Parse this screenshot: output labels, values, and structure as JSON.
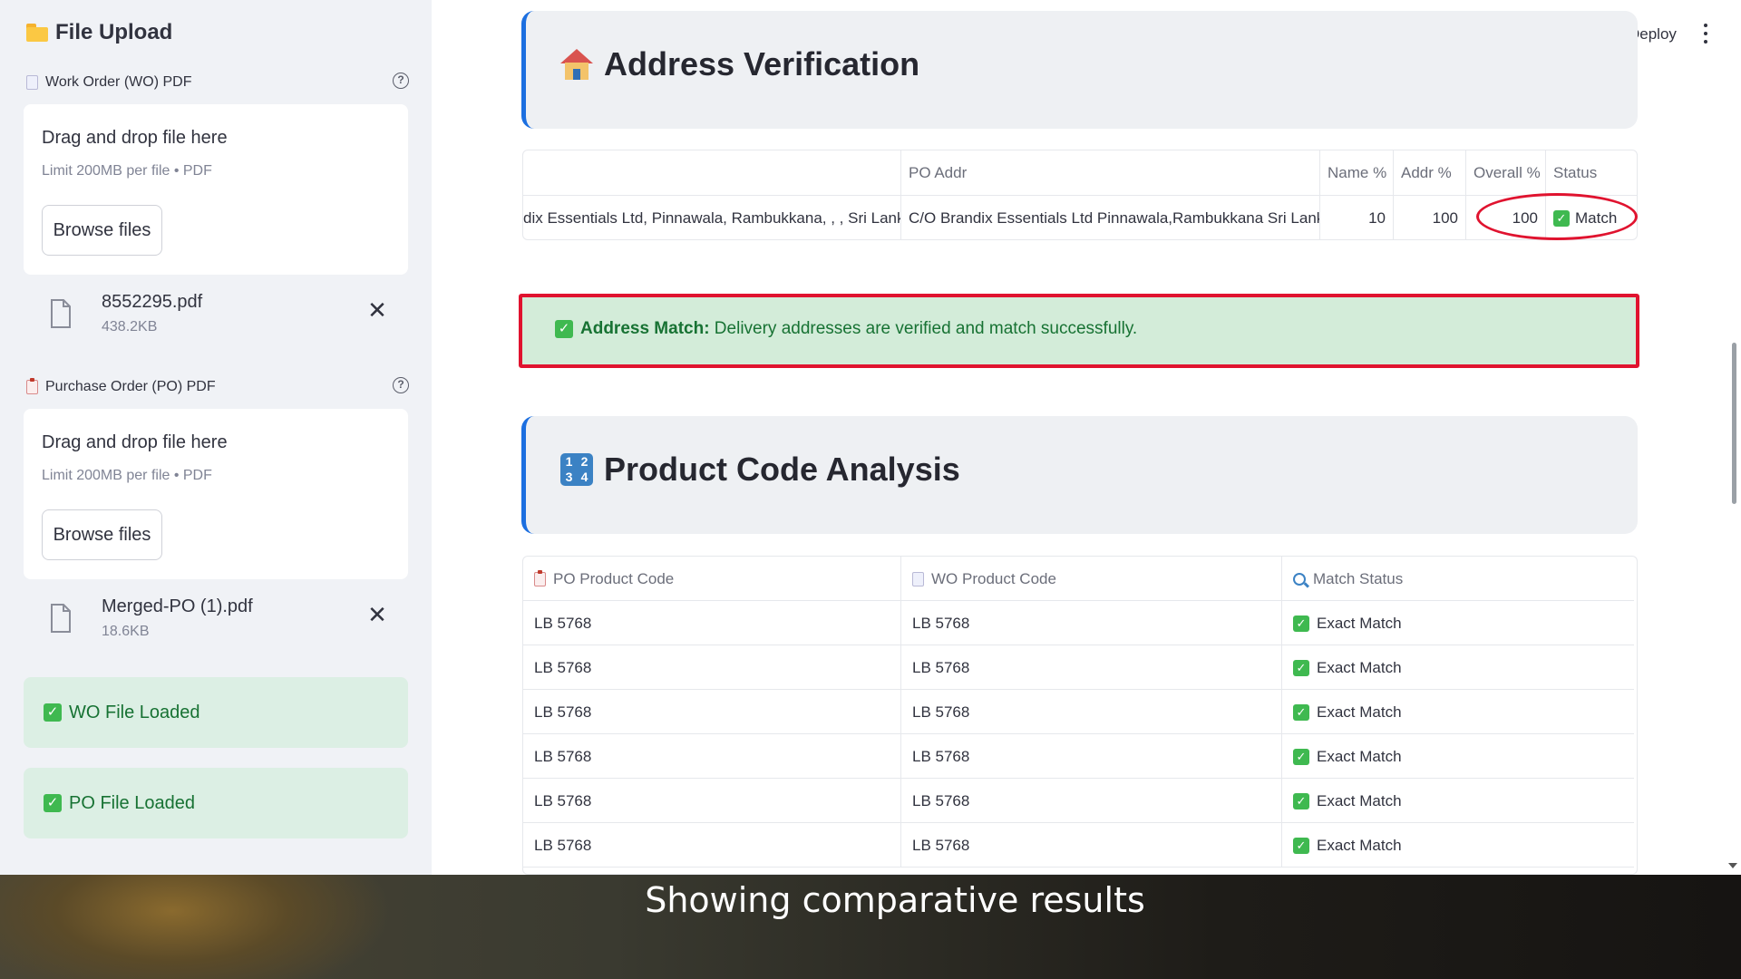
{
  "sidebar": {
    "title": "File Upload",
    "wo_uploader": {
      "label": "Work Order (WO) PDF",
      "help": "?",
      "drop_text": "Drag and drop file here",
      "limit_text": "Limit 200MB per file • PDF",
      "browse_label": "Browse files",
      "file": {
        "name": "8552295.pdf",
        "size": "438.2KB"
      }
    },
    "po_uploader": {
      "label": "Purchase Order (PO) PDF",
      "help": "?",
      "drop_text": "Drag and drop file here",
      "limit_text": "Limit 200MB per file • PDF",
      "browse_label": "Browse files",
      "file": {
        "name": "Merged-PO (1).pdf",
        "size": "18.6KB"
      }
    },
    "status_boxes": [
      "WO File Loaded",
      "PO File Loaded"
    ]
  },
  "header": {
    "deploy_label": "Deploy"
  },
  "address_section": {
    "title": "Address Verification",
    "table": {
      "headers": [
        "",
        "PO Addr",
        "Name %",
        "Addr %",
        "Overall %",
        "Status"
      ],
      "row": {
        "wo_addr": "dix Essentials Ltd, Pinnawala, Rambukkana, , , Sri Lanka",
        "po_addr": "C/O Brandix Essentials Ltd Pinnawala,Rambukkana Sri Lanka",
        "name_pct": "10",
        "addr_pct": "100",
        "overall_pct": "100",
        "status": "Match"
      }
    },
    "alert": {
      "bold": "Address Match:",
      "text": " Delivery addresses are verified and match successfully."
    }
  },
  "product_section": {
    "title": "Product Code Analysis",
    "table": {
      "headers": [
        "PO Product Code",
        "WO Product Code",
        "Match Status"
      ],
      "rows": [
        [
          "LB 5768",
          "LB 5768",
          "Exact Match"
        ],
        [
          "LB 5768",
          "LB 5768",
          "Exact Match"
        ],
        [
          "LB 5768",
          "LB 5768",
          "Exact Match"
        ],
        [
          "LB 5768",
          "LB 5768",
          "Exact Match"
        ],
        [
          "LB 5768",
          "LB 5768",
          "Exact Match"
        ],
        [
          "LB 5768",
          "LB 5768",
          "Exact Match"
        ]
      ]
    }
  },
  "caption": "Showing comparative results",
  "colors": {
    "accent_blue": "#1c6fe0",
    "success_green": "#3fb950",
    "highlight_red": "#e0132f"
  },
  "icons": {
    "title": "folder-icon",
    "address": "house-icon",
    "product": "numbers-icon",
    "match": "check-icon",
    "search": "magnifier-icon"
  }
}
